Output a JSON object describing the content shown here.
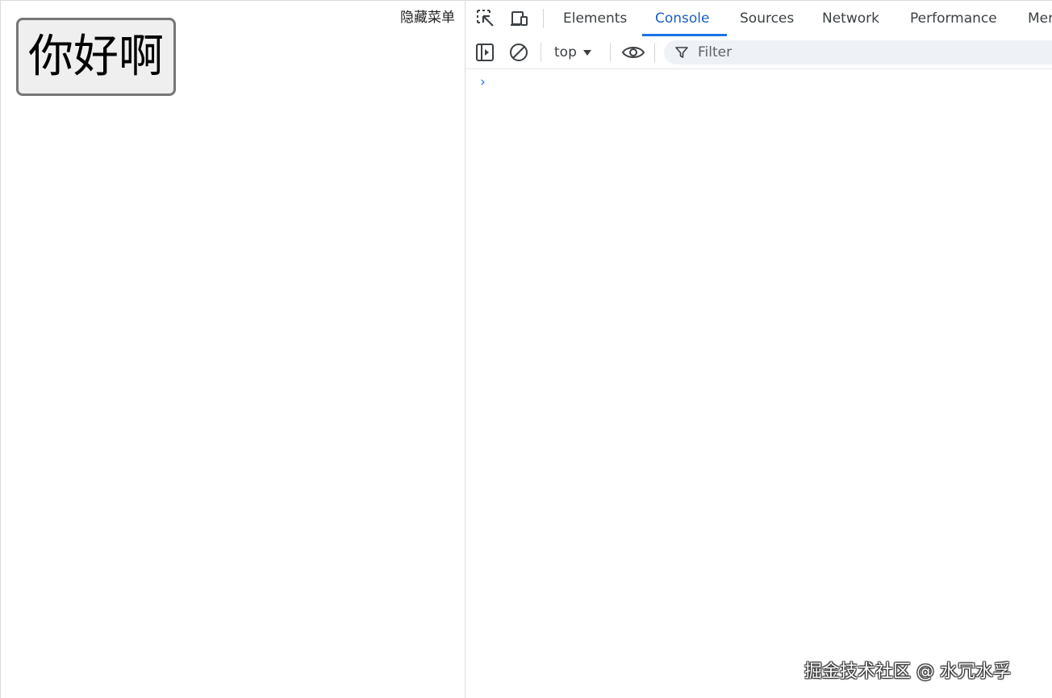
{
  "page": {
    "hello_button_label": "你好啊",
    "hide_menu_label": "隐藏菜单"
  },
  "devtools": {
    "tabs": [
      {
        "label": "Elements",
        "active": false
      },
      {
        "label": "Console",
        "active": true
      },
      {
        "label": "Sources",
        "active": false
      },
      {
        "label": "Network",
        "active": false
      },
      {
        "label": "Performance",
        "active": false
      },
      {
        "label": "Mer",
        "active": false
      }
    ],
    "toolbar": {
      "context_label": "top",
      "filter_placeholder": "Filter"
    },
    "console": {
      "prompt_glyph": "›"
    },
    "icons": {
      "inspect": "inspect-element-icon",
      "device": "device-toolbar-icon",
      "sidebar": "sidebar-toggle-icon",
      "clear": "clear-console-icon",
      "eye": "live-expression-eye-icon",
      "filter": "filter-funnel-icon"
    },
    "colors": {
      "accent": "#1a73e8",
      "active_tab_text": "#1a5fc8",
      "filter_bg": "#eef1f5"
    }
  },
  "watermark": "掘金技术社区 @ 水冗水孚"
}
